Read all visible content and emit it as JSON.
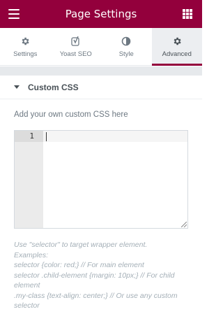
{
  "header": {
    "title": "Page Settings",
    "menu_icon": "hamburger-menu-icon",
    "apps_icon": "grid-apps-icon",
    "background": "#93003c"
  },
  "tabs": [
    {
      "label": "Settings",
      "icon": "gear-icon",
      "active": false
    },
    {
      "label": "Yoast SEO",
      "icon": "yoast-icon",
      "active": false
    },
    {
      "label": "Style",
      "icon": "half-circle-icon",
      "active": false
    },
    {
      "label": "Advanced",
      "icon": "gear-icon",
      "active": true
    }
  ],
  "section": {
    "title": "Custom CSS",
    "expanded": true,
    "description": "Add your own custom CSS here"
  },
  "editor": {
    "line_numbers": [
      "1"
    ],
    "content": ""
  },
  "help": {
    "lines": [
      "Use \"selector\" to target wrapper element.",
      "Examples:",
      "selector {color: red;} // For main element",
      "selector .child-element {margin: 10px;} // For child element",
      ".my-class {text-align: center;} // Or use any custom selector"
    ]
  }
}
